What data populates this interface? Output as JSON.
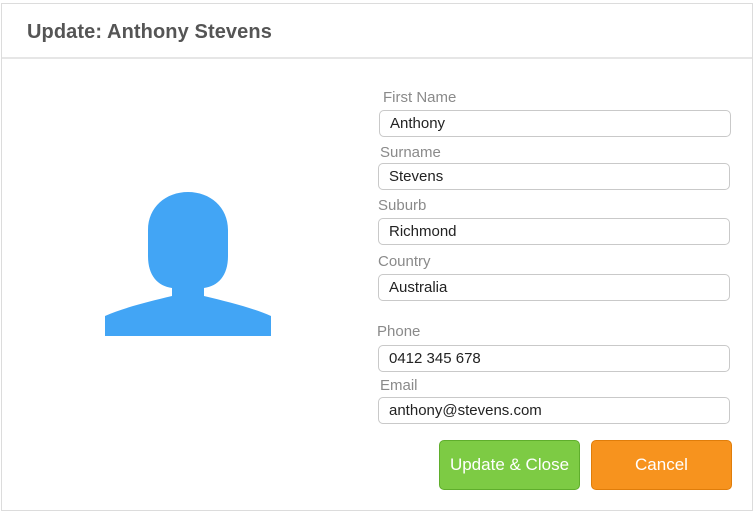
{
  "dialog": {
    "title": "Update: Anthony Stevens"
  },
  "avatar": {
    "icon": "person-silhouette-icon",
    "color": "#42a5f5"
  },
  "form": {
    "first_name": {
      "label": "First Name",
      "value": "Anthony"
    },
    "surname": {
      "label": "Surname",
      "value": "Stevens"
    },
    "suburb": {
      "label": "Suburb",
      "value": "Richmond"
    },
    "country": {
      "label": "Country",
      "value": "Australia"
    },
    "phone": {
      "label": "Phone",
      "value": "0412 345 678"
    },
    "email": {
      "label": "Email",
      "value": "anthony@stevens.com"
    }
  },
  "actions": {
    "update_label": "Update & Close",
    "cancel_label": "Cancel"
  },
  "colors": {
    "update_button": "#7dcb44",
    "cancel_button": "#f7931e"
  }
}
